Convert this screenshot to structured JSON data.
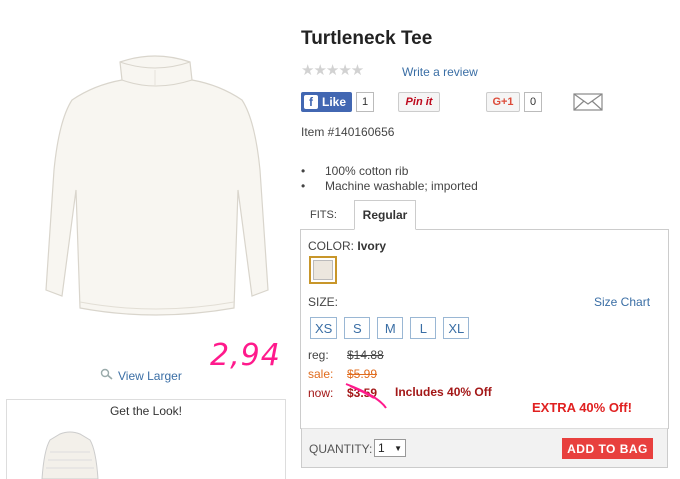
{
  "product": {
    "title": "Turtleneck Tee",
    "rating_stars": "★★★★★",
    "write_review": "Write a review",
    "item_number": "Item #140160656",
    "bullets": [
      "100% cotton rib",
      "Machine washable; imported"
    ],
    "image_icon": "turtleneck-tee-image"
  },
  "social": {
    "fb_label": "Like",
    "fb_count": "1",
    "pin_label": "Pin it",
    "gplus_label": "G+1",
    "gplus_count": "0",
    "mail_icon": "envelope-icon"
  },
  "media": {
    "view_larger": "View Larger",
    "get_the_look": "Get the Look!"
  },
  "options": {
    "fits_label": "FITS:",
    "fits_tab": "Regular",
    "color_label": "COLOR:",
    "color_value": "Ivory",
    "swatch_color": "#ece7de",
    "size_label": "SIZE:",
    "size_chart": "Size Chart",
    "sizes": [
      "XS",
      "S",
      "M",
      "L",
      "XL"
    ]
  },
  "pricing": {
    "reg_label": "reg:",
    "reg_value": "$14.88",
    "sale_label": "sale:",
    "sale_value": "$5.99",
    "now_label": "now:",
    "now_value": "$3.59",
    "includes": "Includes 40% Off",
    "extra": "EXTRA 40% Off!"
  },
  "annotation": {
    "handwritten": "2,94",
    "color": "#ff1a8c"
  },
  "cart": {
    "qty_label": "QUANTITY:",
    "qty_value": "1",
    "add_to_bag": "ADD TO BAG",
    "button_color": "#e8403e"
  }
}
